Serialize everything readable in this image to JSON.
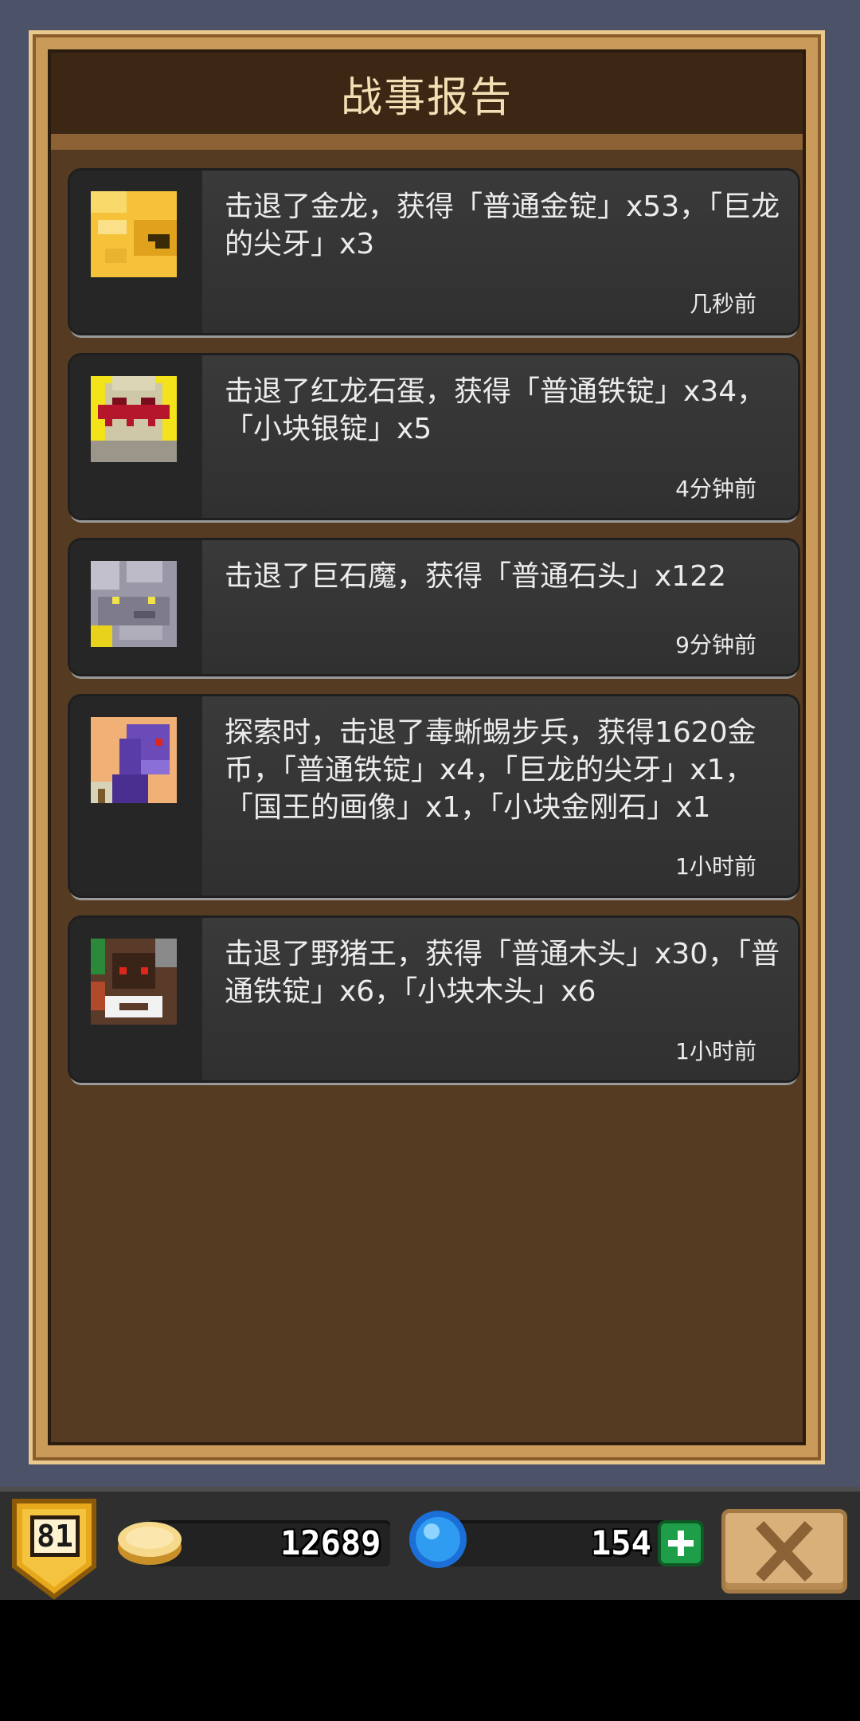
{
  "header": {
    "title": "战事报告"
  },
  "reports": [
    {
      "monster": "golden-dragon",
      "message": "击退了金龙，获得「普通金锭」x53，「巨龙的尖牙」x3",
      "time": "几秒前"
    },
    {
      "monster": "red-dragon-egg",
      "message": "击退了红龙石蛋，获得「普通铁锭」x34，「小块银锭」x5",
      "time": "4分钟前"
    },
    {
      "monster": "stone-golem",
      "message": "击退了巨石魔，获得「普通石头」x122",
      "time": "9分钟前"
    },
    {
      "monster": "poison-lizard-soldier",
      "message": "探索时，击退了毒蜥蜴步兵，获得1620金币，「普通铁锭」x4，「巨龙的尖牙」x1，「国王的画像」x1，「小块金刚石」x1",
      "time": "1小时前"
    },
    {
      "monster": "wild-boar-king",
      "message": "击退了野猪王，获得「普通木头」x30，「普通铁锭」x6，「小块木头」x6",
      "time": "1小时前"
    }
  ],
  "footer": {
    "level": "81",
    "gold": "12689",
    "gems": "154"
  },
  "colors": {
    "frame": "#c99a5a",
    "panel": "#553b22",
    "title_bar": "#3b2713",
    "card": "#363636",
    "plus": "#1f9e4a"
  }
}
